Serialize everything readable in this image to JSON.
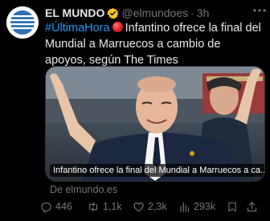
{
  "post": {
    "author_name": "EL MUNDO",
    "handle": "@elmundoes",
    "dot": "·",
    "time": "3h",
    "hashtag": "#ÚltimaHora",
    "text": "Infantino ofrece la final del Mundial a Marruecos a cambio de apoyos, según The Times",
    "card_caption": "Infantino ofrece la final del Mundial a Marruecos a ca...",
    "source": "De elmundo.es"
  },
  "actions": {
    "replies": "446",
    "retweets": "1,1k",
    "likes": "2,3k",
    "views": "293k"
  },
  "colors": {
    "background": "#000000",
    "text": "#e7e9ea",
    "muted": "#71767b",
    "link": "#1d9bf0",
    "verified": "#f4c41f",
    "logo_blue": "#2c6fb4"
  },
  "icons": {
    "avatar": "el-mundo-logo-icon",
    "verified": "verified-badge-icon",
    "more": "more-icon",
    "reply": "reply-icon",
    "retweet": "retweet-icon",
    "like": "heart-icon",
    "views": "views-icon",
    "bookmark": "bookmark-icon",
    "share": "share-icon"
  }
}
